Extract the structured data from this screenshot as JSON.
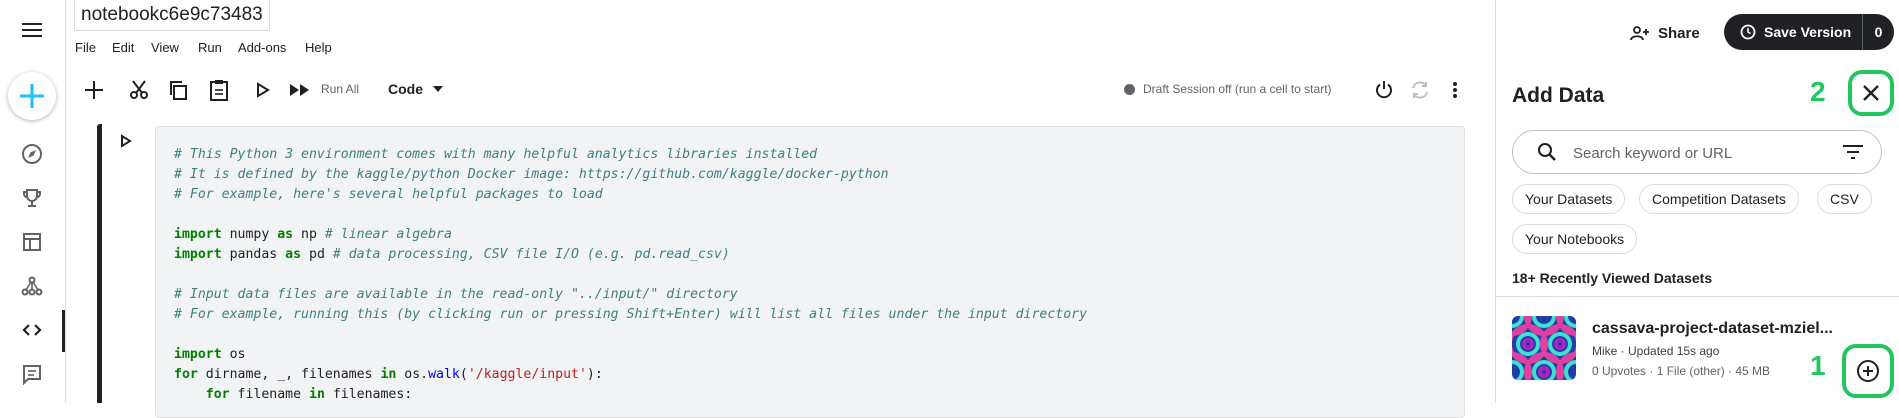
{
  "notebook": {
    "title": "notebookc6e9c73483"
  },
  "menu": [
    "File",
    "Edit",
    "View",
    "Run",
    "Add-ons",
    "Help"
  ],
  "header": {
    "share_label": "Share",
    "save_label": "Save Version",
    "save_count": "0"
  },
  "toolbar": {
    "run_all_label": "Run All",
    "cell_type": "Code",
    "session_status": "Draft Session off (run a cell to start)"
  },
  "panel": {
    "title": "Add Data",
    "search_placeholder": "Search keyword or URL",
    "chips": [
      "Your Datasets",
      "Competition Datasets",
      "CSV",
      "Your Notebooks"
    ],
    "section_label": "18+ Recently Viewed Datasets",
    "dataset": {
      "title": "cassava-project-dataset-mziel...",
      "meta": "Mike · Updated 15s ago",
      "stats": "0 Upvotes · 1 File (other) · 45 MB"
    }
  },
  "annotations": {
    "close_marker": "2",
    "add_marker": "1"
  },
  "colors": {
    "accent": "#20beff",
    "annotation": "#22c55e",
    "dark": "#202124"
  },
  "icons": [
    "hamburger-icon",
    "plus-icon",
    "compass-icon",
    "trophy-icon",
    "table-icon",
    "network-icon",
    "code-icon",
    "comment-icon",
    "share-icon",
    "save-version-icon",
    "scissors-icon",
    "copy-icon",
    "paste-icon",
    "run-icon",
    "run-all-icon",
    "power-icon",
    "refresh-icon",
    "more-vert-icon",
    "close-icon",
    "search-icon",
    "filter-icon",
    "add-circle-icon"
  ],
  "code": {
    "lines": [
      {
        "parts": [
          {
            "t": "# This Python 3 environment comes with many helpful analytics libraries installed",
            "c": "cm"
          }
        ]
      },
      {
        "parts": [
          {
            "t": "# It is defined by the kaggle/python Docker image: https://github.com/kaggle/docker-python",
            "c": "cm"
          }
        ]
      },
      {
        "parts": [
          {
            "t": "# For example, here's several helpful packages to load",
            "c": "cm"
          }
        ]
      },
      {
        "parts": []
      },
      {
        "parts": [
          {
            "t": "import",
            "c": "kw"
          },
          {
            "t": " numpy ",
            "c": ""
          },
          {
            "t": "as",
            "c": "kw"
          },
          {
            "t": " np ",
            "c": ""
          },
          {
            "t": "# linear algebra",
            "c": "cm"
          }
        ]
      },
      {
        "parts": [
          {
            "t": "import",
            "c": "kw"
          },
          {
            "t": " pandas ",
            "c": ""
          },
          {
            "t": "as",
            "c": "kw"
          },
          {
            "t": " pd ",
            "c": ""
          },
          {
            "t": "# data processing, CSV file I/O (e.g. pd.read_csv)",
            "c": "cm"
          }
        ]
      },
      {
        "parts": []
      },
      {
        "parts": [
          {
            "t": "# Input data files are available in the read-only \"../input/\" directory",
            "c": "cm"
          }
        ]
      },
      {
        "parts": [
          {
            "t": "# For example, running this (by clicking run or pressing Shift+Enter) will list all files under the input directory",
            "c": "cm"
          }
        ]
      },
      {
        "parts": []
      },
      {
        "parts": [
          {
            "t": "import",
            "c": "kw"
          },
          {
            "t": " os",
            "c": ""
          }
        ]
      },
      {
        "parts": [
          {
            "t": "for",
            "c": "kw"
          },
          {
            "t": " dirname, _, filenames ",
            "c": ""
          },
          {
            "t": "in",
            "c": "kw"
          },
          {
            "t": " os.",
            "c": ""
          },
          {
            "t": "walk",
            "c": "fn"
          },
          {
            "t": "(",
            "c": ""
          },
          {
            "t": "'/kaggle/input'",
            "c": "str"
          },
          {
            "t": "):",
            "c": ""
          }
        ]
      },
      {
        "parts": [
          {
            "t": "    ",
            "c": ""
          },
          {
            "t": "for",
            "c": "kw"
          },
          {
            "t": " filename ",
            "c": ""
          },
          {
            "t": "in",
            "c": "kw"
          },
          {
            "t": " filenames:",
            "c": ""
          }
        ]
      }
    ]
  }
}
